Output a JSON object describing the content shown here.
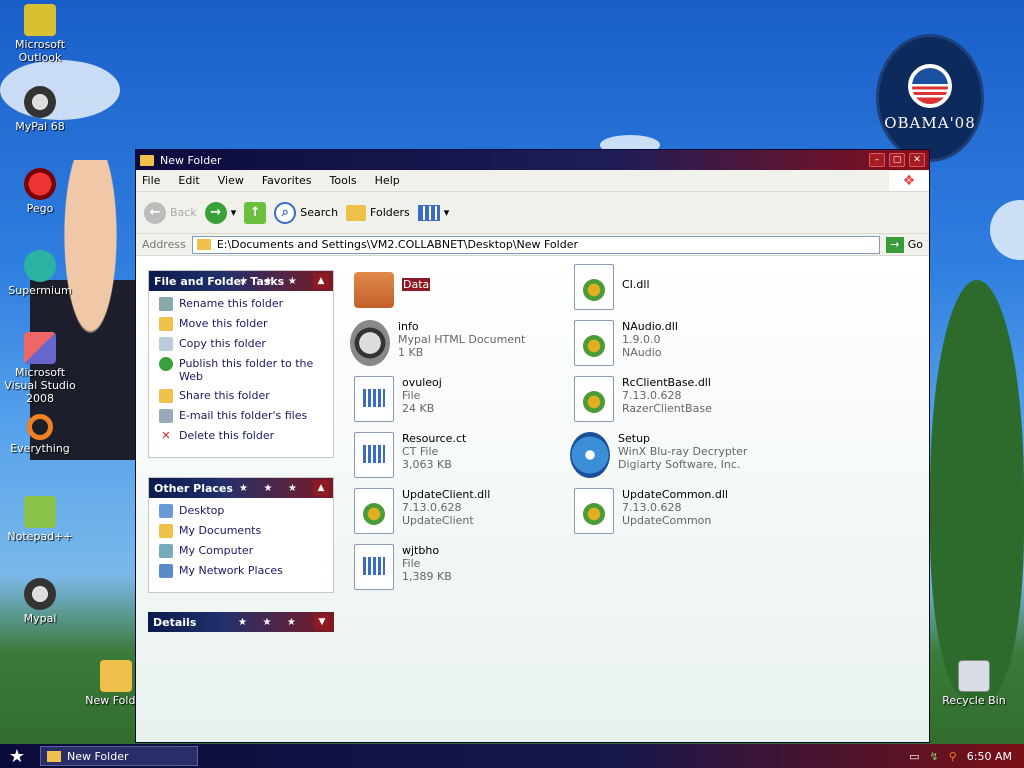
{
  "desktop": {
    "icons": [
      {
        "label": "Microsoft Outlook"
      },
      {
        "label": "MyPal 68"
      },
      {
        "label": "Pego"
      },
      {
        "label": "Supermium"
      },
      {
        "label": "Microsoft Visual Studio 2008"
      },
      {
        "label": "Everything"
      },
      {
        "label": "Notepad++"
      },
      {
        "label": "Mypal"
      },
      {
        "label": "New Folder"
      },
      {
        "label": "Recycle Bin"
      }
    ],
    "badge_text": "OBAMA'08"
  },
  "window": {
    "title": "New Folder",
    "menu": [
      "File",
      "Edit",
      "View",
      "Favorites",
      "Tools",
      "Help"
    ],
    "toolbar": {
      "back": "Back",
      "search": "Search",
      "folders": "Folders"
    },
    "address": {
      "label": "Address",
      "path": "E:\\Documents and Settings\\VM2.COLLABNET\\Desktop\\New Folder",
      "go": "Go"
    },
    "tasks_panel": {
      "title": "File and Folder Tasks",
      "items": [
        "Rename this folder",
        "Move this folder",
        "Copy this folder",
        "Publish this folder to the Web",
        "Share this folder",
        "E-mail this folder's files",
        "Delete this folder"
      ]
    },
    "places_panel": {
      "title": "Other Places",
      "items": [
        "Desktop",
        "My Documents",
        "My Computer",
        "My Network Places"
      ]
    },
    "details_panel": {
      "title": "Details"
    },
    "files": [
      {
        "name": "Data",
        "line2": "",
        "line3": "",
        "type": "folder"
      },
      {
        "name": "CI.dll",
        "line2": "",
        "line3": "",
        "type": "dll"
      },
      {
        "name": "info",
        "line2": "Mypal HTML Document",
        "line3": "1 KB",
        "type": "raccoon"
      },
      {
        "name": "NAudio.dll",
        "line2": "1.9.0.0",
        "line3": "NAudio",
        "type": "dll"
      },
      {
        "name": "ovuleoj",
        "line2": "File",
        "line3": "24 KB",
        "type": "doc"
      },
      {
        "name": "RcClientBase.dll",
        "line2": "7.13.0.628",
        "line3": "RazerClientBase",
        "type": "dll"
      },
      {
        "name": "Resource.ct",
        "line2": "CT File",
        "line3": "3,063 KB",
        "type": "doc"
      },
      {
        "name": "Setup",
        "line2": "WinX Blu-ray Decrypter",
        "line3": "Digiarty Software, Inc.",
        "type": "setup"
      },
      {
        "name": "UpdateClient.dll",
        "line2": "7.13.0.628",
        "line3": "UpdateClient",
        "type": "dll"
      },
      {
        "name": "UpdateCommon.dll",
        "line2": "7.13.0.628",
        "line3": "UpdateCommon",
        "type": "dll"
      },
      {
        "name": "wjtbho",
        "line2": "File",
        "line3": "1,389 KB",
        "type": "doc"
      }
    ]
  },
  "taskbar": {
    "task_label": "New Folder",
    "clock": "6:50 AM"
  }
}
